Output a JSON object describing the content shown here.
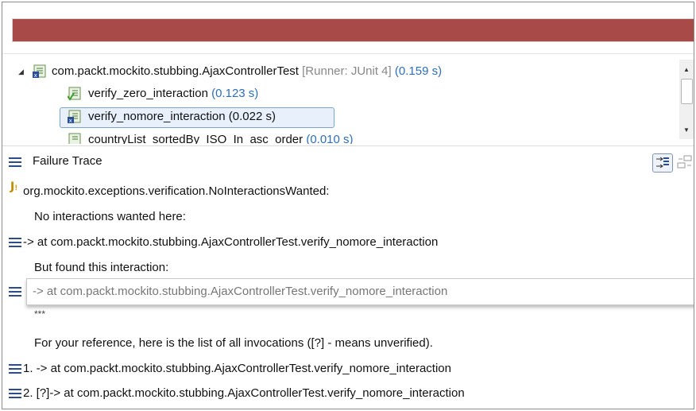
{
  "progress": {
    "state": "failed",
    "color": "#a84a47",
    "fill": 1.0
  },
  "tree": {
    "root": {
      "name": "com.packt.mockito.stubbing.AjaxControllerTest",
      "runner": "[Runner: JUnit 4]",
      "time": "(0.159 s)"
    },
    "items": [
      {
        "name": "verify_zero_interaction",
        "time": "(0.123 s)",
        "status": "passed"
      },
      {
        "name": "verify_nomore_interaction (0.022 s)",
        "time": "",
        "status": "failed"
      },
      {
        "name": "countryList_sortedBy_ISO_In_asc_order",
        "time": "(0.010 s)",
        "status": "passed"
      }
    ]
  },
  "trace": {
    "title": "Failure Trace",
    "lines": [
      "org.mockito.exceptions.verification.NoInteractionsWanted:",
      "No interactions wanted here:",
      "-> at com.packt.mockito.stubbing.AjaxControllerTest.verify_nomore_interaction",
      "But found this interaction:",
      "-> at com.packt.mockito.stubbing.AjaxControllerTest.verify_nomore_interaction",
      "***",
      "For your reference, here is the list of all invocations ([?] - means unverified).",
      "1. -> at com.packt.mockito.stubbing.AjaxControllerTest.verify_nomore_interaction",
      "2. [?]-> at com.packt.mockito.stubbing.AjaxControllerTest.verify_nomore_interaction"
    ]
  }
}
